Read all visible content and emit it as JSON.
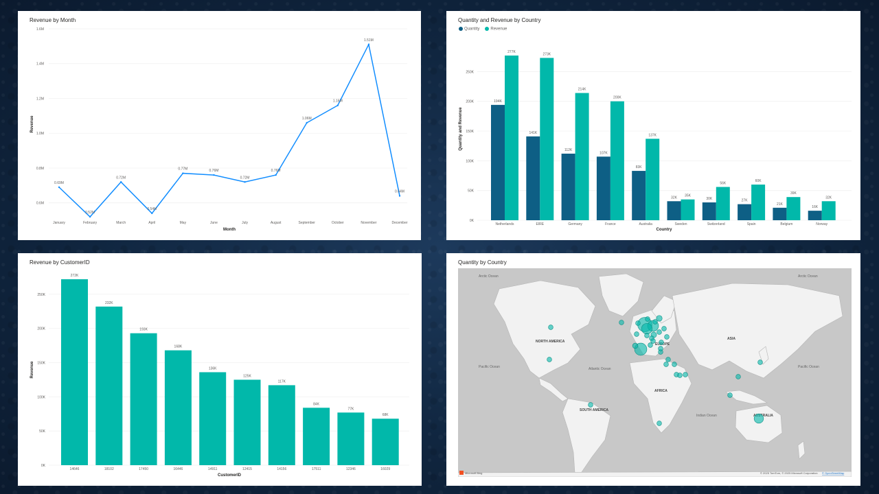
{
  "chart_data": [
    {
      "type": "line",
      "title": "Revenue by Month",
      "xlabel": "Month",
      "ylabel": "Revenue",
      "categories": [
        "January",
        "February",
        "March",
        "April",
        "May",
        "June",
        "July",
        "August",
        "September",
        "October",
        "November",
        "December"
      ],
      "values": [
        0.69,
        0.52,
        0.72,
        0.54,
        0.77,
        0.76,
        0.72,
        0.76,
        1.06,
        1.16,
        1.51,
        0.64
      ],
      "labels": [
        "0.69M",
        "0.52M",
        "0.72M",
        "0.54M",
        "0.77M",
        "0.76M",
        "0.72M",
        "0.76M",
        "1.06M",
        "1.16M",
        "1.51M",
        "0.64M"
      ],
      "yticks": [
        "0.6M",
        "0.8M",
        "1.0M",
        "1.2M",
        "1.4M",
        "1.6M"
      ],
      "ylim": [
        0.52,
        1.6
      ],
      "color": "#118dff"
    },
    {
      "type": "bar",
      "title": "Quantity and Revenue by Country",
      "xlabel": "Country",
      "ylabel": "Quantity and Revenue",
      "categories": [
        "Netherlands",
        "EIRE",
        "Germany",
        "France",
        "Australia",
        "Sweden",
        "Switzerland",
        "Spain",
        "Belgium",
        "Norway"
      ],
      "series": [
        {
          "name": "Quantity",
          "values": [
            194,
            141,
            112,
            107,
            83,
            32,
            30,
            27,
            21,
            16
          ],
          "labels": [
            "194K",
            "141K",
            "112K",
            "107K",
            "83K",
            "32K",
            "30K",
            "27K",
            "21K",
            "16K"
          ],
          "color": "#0e5f85"
        },
        {
          "name": "Revenue",
          "values": [
            277,
            273,
            214,
            200,
            137,
            35,
            56,
            60,
            39,
            32
          ],
          "labels": [
            "277K",
            "273K",
            "214K",
            "200K",
            "137K",
            "35K",
            "56K",
            "60K",
            "39K",
            "32K"
          ],
          "color": "#01b8aa"
        }
      ],
      "yticks": [
        "0K",
        "50K",
        "100K",
        "150K",
        "200K",
        "250K"
      ],
      "ylim": [
        0,
        300
      ],
      "legend": "top-left"
    },
    {
      "type": "bar",
      "title": "Revenue by CustomerID",
      "xlabel": "CustomerID",
      "ylabel": "Revenue",
      "categories": [
        "14646",
        "18102",
        "17450",
        "16446",
        "14911",
        "12415",
        "14156",
        "17511",
        "12346",
        "16029"
      ],
      "values": [
        272,
        232,
        193,
        168,
        136,
        125,
        117,
        84,
        77,
        68
      ],
      "labels": [
        "272K",
        "232K",
        "193K",
        "168K",
        "136K",
        "125K",
        "117K",
        "84K",
        "77K",
        "68K"
      ],
      "yticks": [
        "0K",
        "50K",
        "100K",
        "150K",
        "200K",
        "250K"
      ],
      "ylim": [
        0,
        280
      ],
      "color": "#01b8aa"
    }
  ],
  "map": {
    "title": "Quantity by Country",
    "labels": {
      "arctic_left": "Arctic Ocean",
      "arctic_right": "Arctic Ocean",
      "north_america": "NORTH AMERICA",
      "asia": "ASIA",
      "europe": "EUROPE",
      "pacific_left": "Pacific Ocean",
      "pacific_right": "Pacific Ocean",
      "atlantic": "Atlantic Ocean",
      "africa": "AFRICA",
      "south_america": "SOUTH AMERICA",
      "indian": "Indian Ocean",
      "australia": "AUSTRALIA"
    },
    "logo_text": "Microsoft Bing",
    "copyright": "© 2025 TomTom, © 2025 Microsoft Corporation",
    "osm_link": "© OpenStreetMap",
    "bubble_color": "#01b8aa",
    "bubble_qty": [
      194,
      141,
      112,
      107,
      83,
      32,
      30,
      27,
      21,
      16,
      12,
      10,
      9,
      8,
      7,
      6,
      6,
      5,
      5,
      4,
      4,
      3,
      3,
      3,
      2,
      2,
      2,
      2,
      2,
      2,
      2,
      1,
      1,
      1,
      1,
      1
    ]
  }
}
